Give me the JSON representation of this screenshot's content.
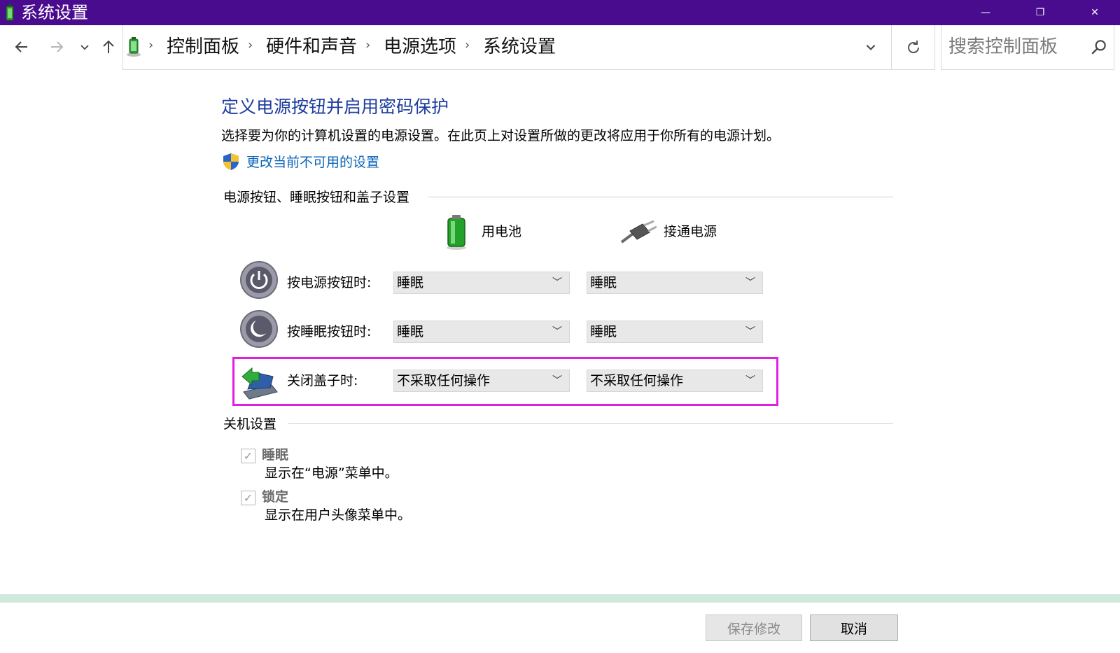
{
  "window": {
    "title": "系统设置",
    "minimize_icon": "—",
    "restore_icon": "❐",
    "close_icon": "✕"
  },
  "nav": {
    "back_icon": "arrow-left",
    "forward_icon": "arrow-right",
    "recent_icon": "chevron-down",
    "up_icon": "arrow-up",
    "breadcrumbs": [
      "控制面板",
      "硬件和声音",
      "电源选项",
      "系统设置"
    ],
    "search_placeholder": "搜索控制面板"
  },
  "content": {
    "heading": "定义电源按钮并启用密码保护",
    "description": "选择要为你的计算机设置的电源设置。在此页上对设置所做的更改将应用于你所有的电源计划。",
    "admin_link": "更改当前不可用的设置",
    "power_group": {
      "title": "电源按钮、睡眠按钮和盖子设置",
      "col_battery": "用电池",
      "col_plugged": "接通电源",
      "rows": [
        {
          "label": "按电源按钮时:",
          "battery": "睡眠",
          "plugged": "睡眠"
        },
        {
          "label": "按睡眠按钮时:",
          "battery": "睡眠",
          "plugged": "睡眠"
        },
        {
          "label": "关闭盖子时:",
          "battery": "不采取任何操作",
          "plugged": "不采取任何操作"
        }
      ]
    },
    "shutdown_group": {
      "title": "关机设置",
      "items": [
        {
          "title": "睡眠",
          "desc": "显示在“电源”菜单中。",
          "checked": true
        },
        {
          "title": "锁定",
          "desc": "显示在用户头像菜单中。",
          "checked": true
        }
      ]
    }
  },
  "footer": {
    "save_label": "保存修改",
    "cancel_label": "取消"
  },
  "colors": {
    "titlebar": "#4a0c8e",
    "heading": "#1e3c9e",
    "link": "#0a64b8",
    "highlight": "#e21ee2",
    "footer_strip": "#cfeadc"
  }
}
